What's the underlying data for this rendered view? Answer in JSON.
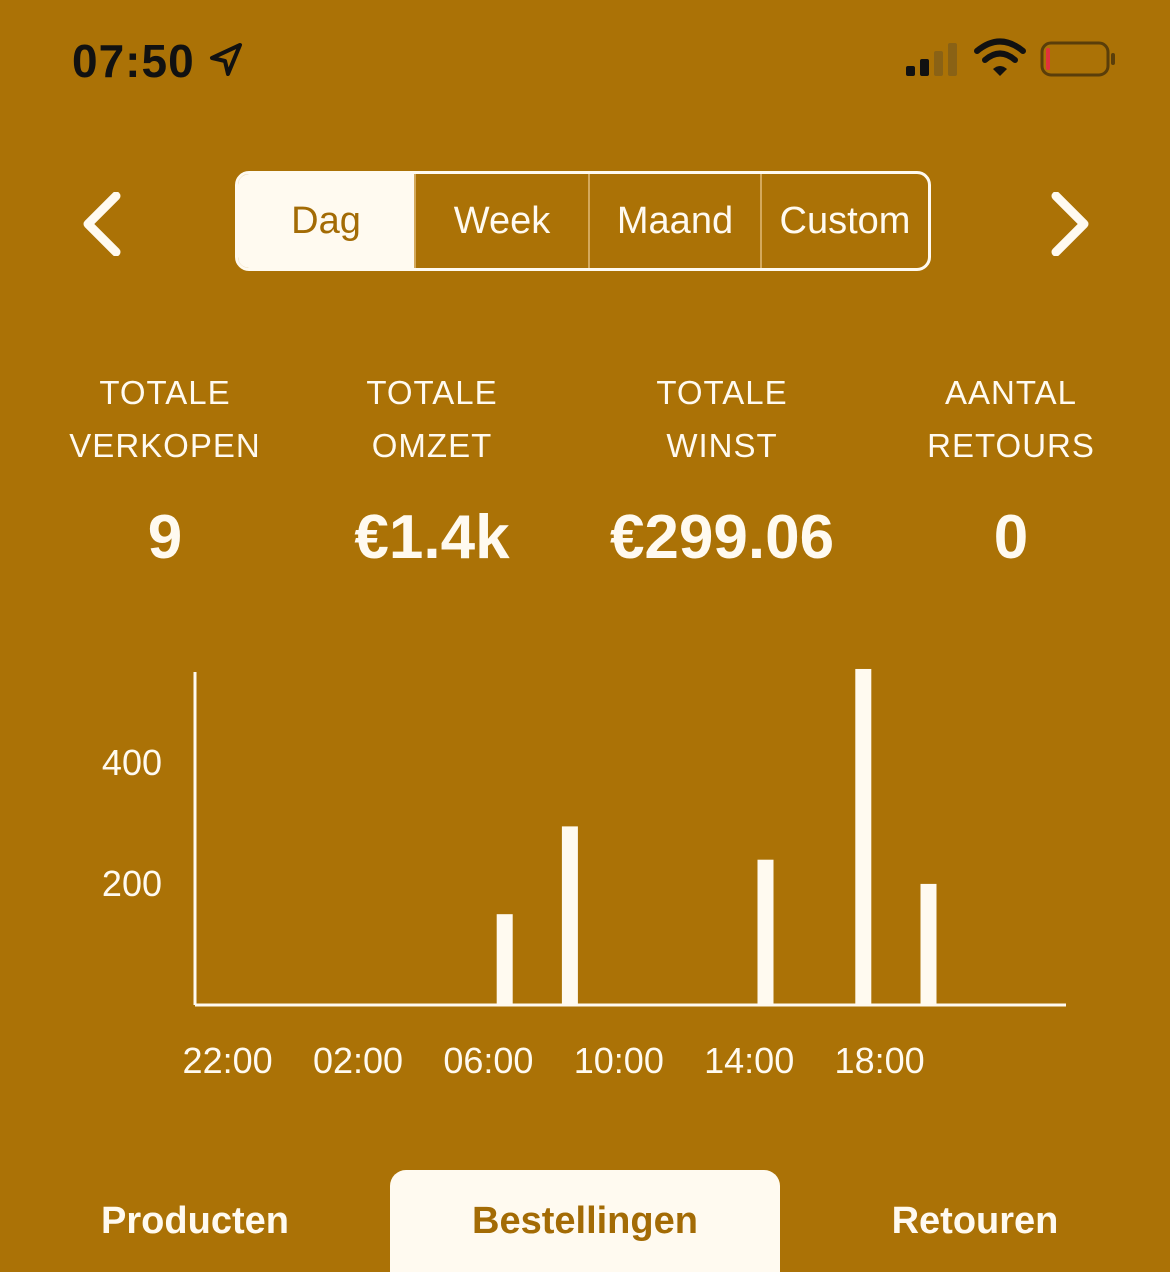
{
  "status_bar": {
    "time": "07:50",
    "icons": [
      "location-arrow-icon",
      "cellular-signal-icon",
      "wifi-icon",
      "battery-low-icon"
    ],
    "battery_level": 0.05
  },
  "period_selector": {
    "prev_icon": "chevron-left-icon",
    "next_icon": "chevron-right-icon",
    "segments": [
      "Dag",
      "Week",
      "Maand",
      "Custom"
    ],
    "selected": "Dag"
  },
  "stats": [
    {
      "label": "TOTALE\nVERKOPEN",
      "value": "9"
    },
    {
      "label": "TOTALE\nOMZET",
      "value": "€1.4k"
    },
    {
      "label": "TOTALE\nWINST",
      "value": "€299.06"
    },
    {
      "label": "AANTAL\nRETOURS",
      "value": "0"
    }
  ],
  "chart_data": {
    "type": "bar",
    "x": [
      "22:00",
      "23:00",
      "00:00",
      "01:00",
      "02:00",
      "03:00",
      "04:00",
      "05:00",
      "06:00",
      "07:00",
      "08:00",
      "09:00",
      "10:00",
      "11:00",
      "12:00",
      "13:00",
      "14:00",
      "15:00",
      "16:00",
      "17:00",
      "18:00",
      "19:00",
      "20:00",
      "21:00"
    ],
    "values": [
      0,
      0,
      0,
      0,
      0,
      0,
      0,
      0,
      0,
      150,
      0,
      295,
      0,
      0,
      0,
      0,
      0,
      240,
      0,
      0,
      555,
      0,
      200,
      0
    ],
    "x_ticks": [
      "22:00",
      "02:00",
      "06:00",
      "10:00",
      "14:00",
      "18:00"
    ],
    "y_ticks": [
      "200",
      "400"
    ],
    "ylim": [
      0,
      550
    ],
    "grid": false,
    "colors": {
      "bar": "#fffaf0",
      "axis": "#fffaf0"
    }
  },
  "tabs": {
    "items": [
      "Producten",
      "Bestellingen",
      "Retouren"
    ],
    "selected": "Bestellingen"
  },
  "colors": {
    "background": "#ab7206",
    "foreground": "#fffaf0",
    "accent_text": "#a36b05"
  }
}
